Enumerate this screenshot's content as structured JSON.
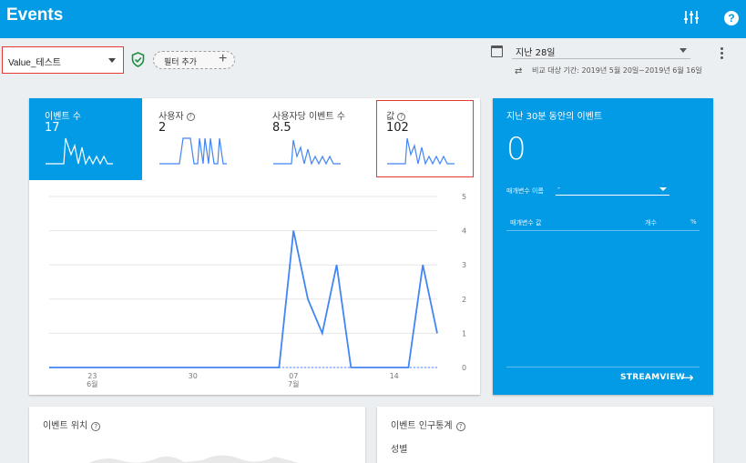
{
  "header": {
    "title": "Events"
  },
  "segment": {
    "selected": "Value_테스트"
  },
  "filter": {
    "add_label": "필터 추가"
  },
  "date": {
    "selected": "지난 28일",
    "compare_text": "비교 대상 기간: 2019년 5월 20일~2019년 6월 16일"
  },
  "metrics": [
    {
      "label": "이벤트 수",
      "value": "17"
    },
    {
      "label": "사용자",
      "value": "2"
    },
    {
      "label": "사용자당 이벤트 수",
      "value": "8.5"
    },
    {
      "label": "값",
      "value": "102"
    }
  ],
  "chart_data": {
    "type": "line",
    "x": [
      "6/20",
      "6/21",
      "6/22",
      "6/23",
      "6/24",
      "6/25",
      "6/26",
      "6/27",
      "6/28",
      "6/29",
      "6/30",
      "7/1",
      "7/2",
      "7/3",
      "7/4",
      "7/5",
      "7/6",
      "7/7",
      "7/8",
      "7/9",
      "7/10",
      "7/11",
      "7/12",
      "7/13",
      "7/14",
      "7/15",
      "7/16",
      "7/17"
    ],
    "series": [
      {
        "values": [
          0,
          0,
          0,
          0,
          0,
          0,
          0,
          0,
          0,
          0,
          0,
          0,
          0,
          0,
          0,
          0,
          0,
          4,
          2,
          1,
          3,
          0,
          0,
          0,
          0,
          0,
          3,
          1
        ]
      }
    ],
    "x_ticks": [
      {
        "day": "23",
        "month": "6월"
      },
      {
        "day": "30",
        "month": ""
      },
      {
        "day": "07",
        "month": "7월"
      },
      {
        "day": "14",
        "month": ""
      }
    ],
    "y_ticks": [
      "5",
      "4",
      "3",
      "2",
      "1",
      "0"
    ],
    "ylim": [
      0,
      5
    ],
    "grid": true
  },
  "realtime": {
    "title": "지난 30분 동안의 이벤트",
    "value": "0",
    "param_label": "매개변수 이름",
    "param_selected": "-",
    "col_value": "매개변수 값",
    "col_count": "개수",
    "col_pct": "%",
    "streamview_label": "STREAMVIEW"
  },
  "location": {
    "title": "이벤트 위치"
  },
  "demographics": {
    "title": "이벤트 인구통계",
    "gender_label": "성별"
  },
  "colors": {
    "primary": "#039be5",
    "line": "#4285f4",
    "highlight": "#e53935"
  }
}
